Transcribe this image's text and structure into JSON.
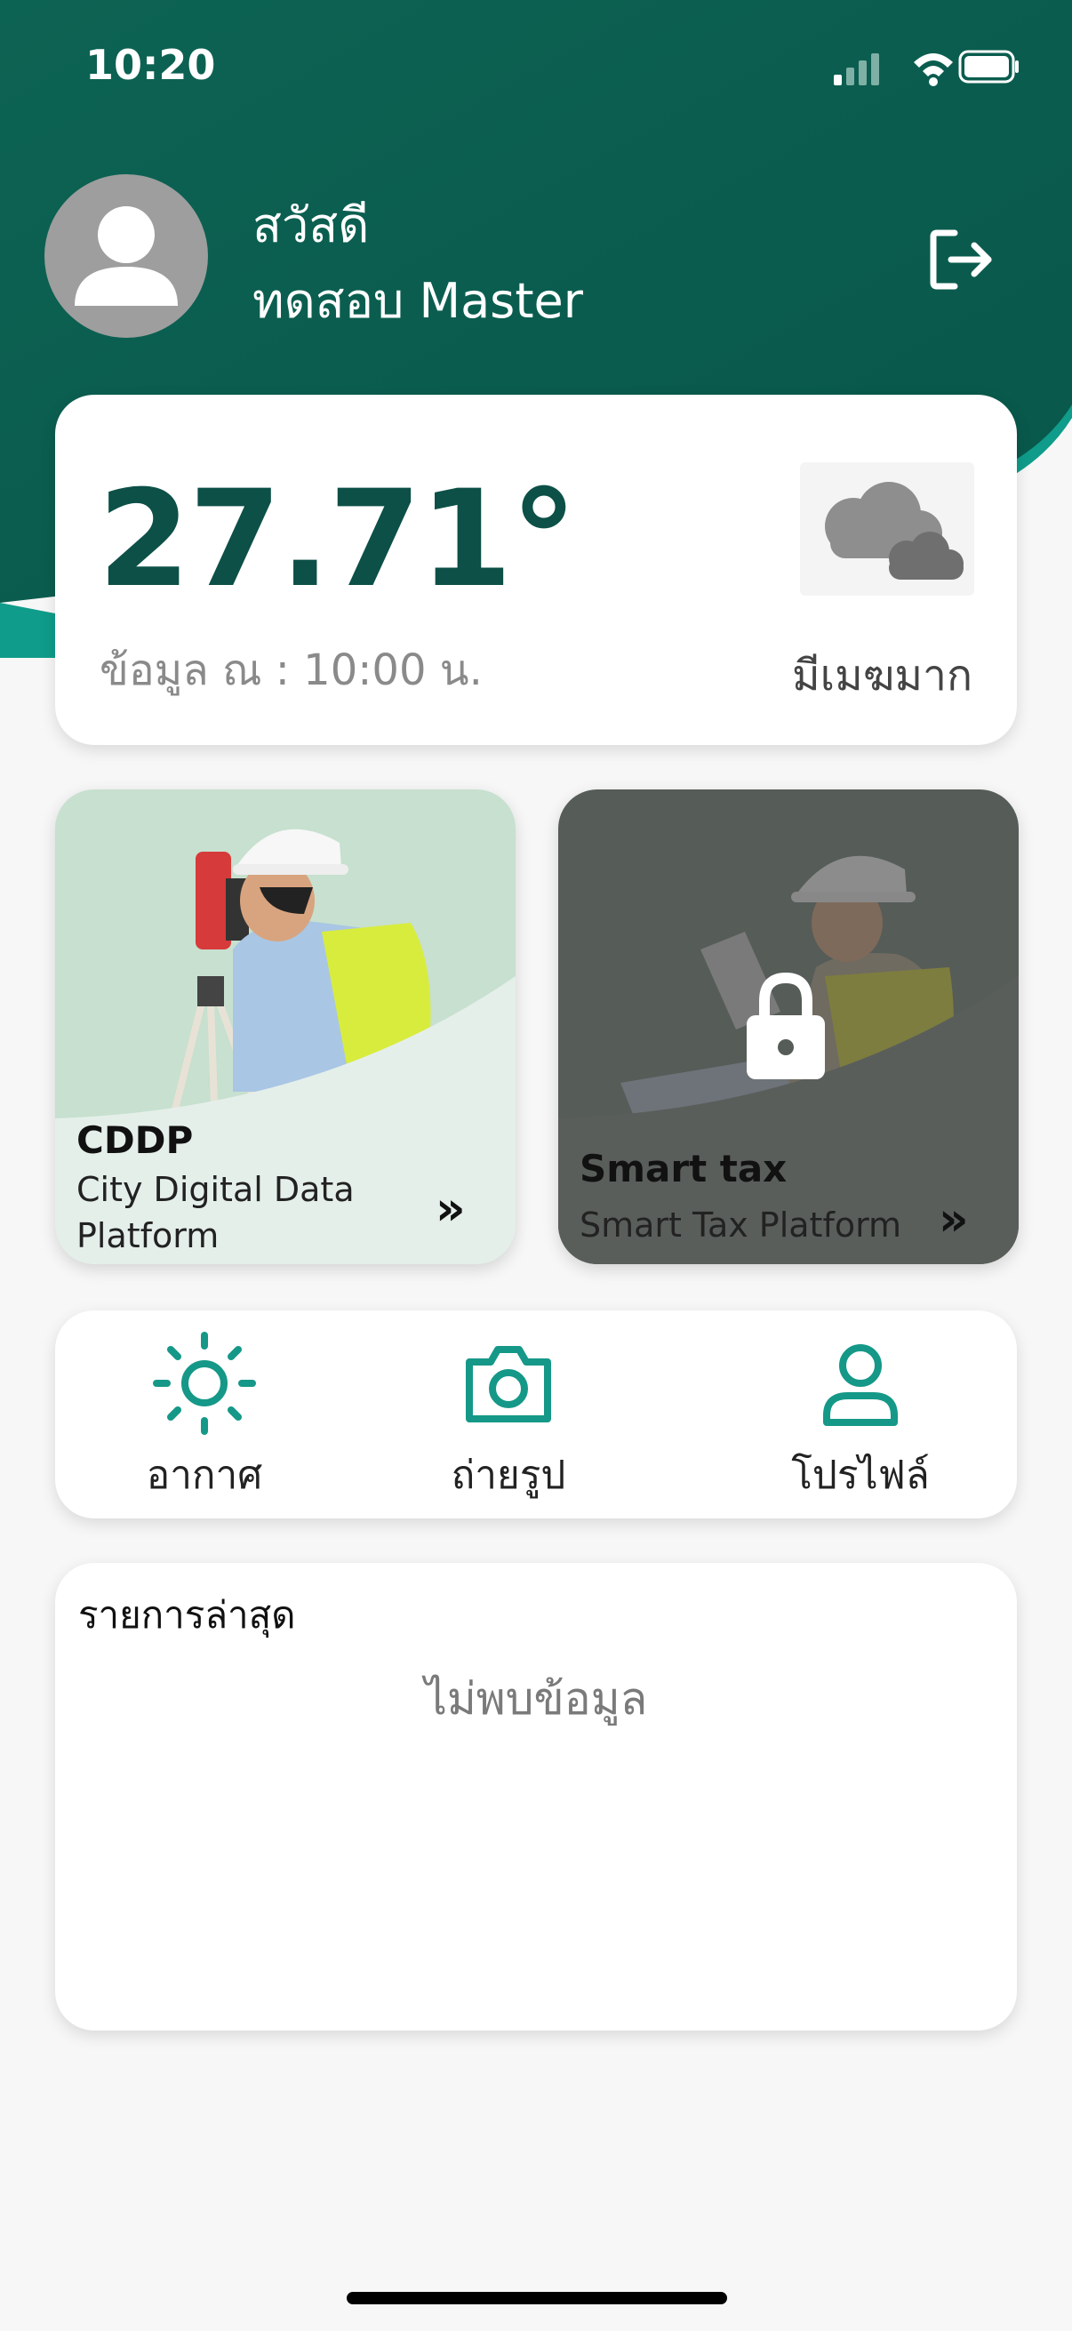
{
  "status_bar": {
    "time": "10:20",
    "icons": [
      "signal-icon",
      "wifi-icon",
      "battery-icon"
    ]
  },
  "header": {
    "greeting": "สวัสดี",
    "user_name": "ทดสอบ Master",
    "logout_icon": "logout-icon"
  },
  "weather": {
    "temperature": "27.71°",
    "data_time": "ข้อมูล ณ : 10:00 น.",
    "description": "มีเมฆมาก",
    "icon": "cloud-icon"
  },
  "services": [
    {
      "title": "CDDP",
      "subtitle_line1": "City Digital Data",
      "subtitle_line2": "Platform",
      "arrow": "»",
      "locked": false
    },
    {
      "title": "Smart tax",
      "subtitle": "Smart Tax Platform",
      "arrow": "»",
      "locked": true
    }
  ],
  "quick_actions": [
    {
      "label": "อากาศ",
      "icon": "sun-icon"
    },
    {
      "label": "ถ่ายรูป",
      "icon": "camera-icon"
    },
    {
      "label": "โปรไฟล์",
      "icon": "user-icon"
    }
  ],
  "recent": {
    "title": "รายการล่าสุด",
    "empty_text": "ไม่พบข้อมูล"
  },
  "colors": {
    "header_dark": "#0b5a4c",
    "header_accent": "#0f9c8a",
    "temperature": "#0c5047",
    "icon_teal": "#159888",
    "cddp_bg": "#c7e0cf",
    "tax_bg": "#565c58"
  }
}
